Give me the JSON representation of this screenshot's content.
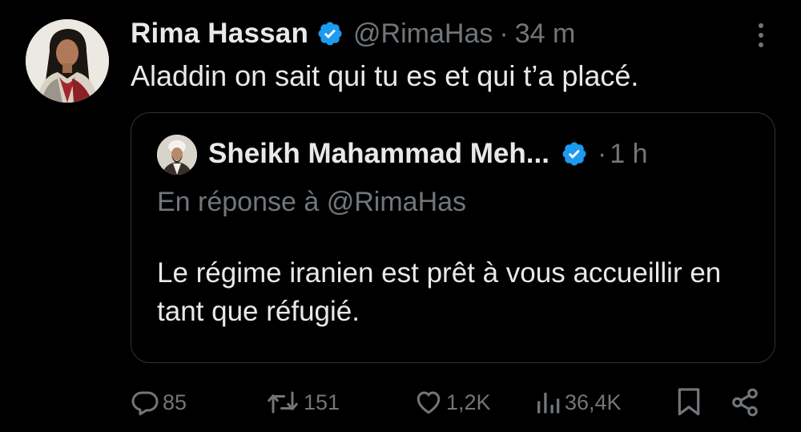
{
  "tweet": {
    "author_name": "Rima Hassan",
    "handle": "@RimaHas",
    "separator": "·",
    "time": "34 m",
    "text": "Aladdin on sait qui tu es et qui t’a placé.",
    "avatar_icon": "profile-photo-woman",
    "verified_icon": "verified-badge-icon"
  },
  "quote": {
    "author_name": "Sheikh Mahammad Meh...",
    "separator": "·",
    "time": "1 h",
    "reply_prefix": "En réponse à",
    "reply_handle": "@RimaHas",
    "text": "Le régime iranien est prêt à vous accueillir en tant que réfugié.",
    "avatar_icon": "profile-photo-cleric"
  },
  "actions": {
    "reply_count": "85",
    "retweet_count": "151",
    "like_count": "1,2K",
    "views_count": "36,4K"
  },
  "colors": {
    "background": "#000000",
    "text_primary": "#e7e9ea",
    "text_secondary": "#71767b",
    "verified_blue": "#1d9bf0",
    "border": "#2f3336"
  }
}
